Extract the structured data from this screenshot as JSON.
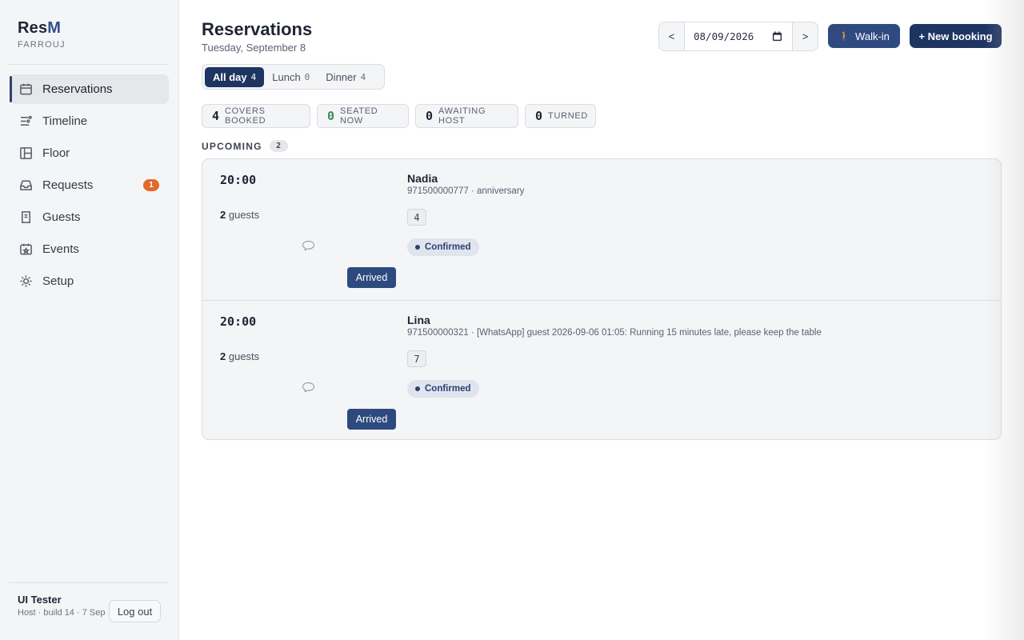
{
  "brand": {
    "name_prefix": "Res",
    "name_suffix": "M",
    "subtitle": "FARROUJ"
  },
  "nav": {
    "items": [
      {
        "label": "Reservations",
        "icon": "calendar-icon",
        "active": true
      },
      {
        "label": "Timeline",
        "icon": "timeline-icon"
      },
      {
        "label": "Floor",
        "icon": "floor-plan-icon"
      },
      {
        "label": "Requests",
        "icon": "inbox-icon",
        "badge": "1"
      },
      {
        "label": "Guests",
        "icon": "guests-book-icon"
      },
      {
        "label": "Events",
        "icon": "event-calendar-icon"
      },
      {
        "label": "Setup",
        "icon": "gear-icon"
      }
    ]
  },
  "user": {
    "name": "UI Tester",
    "role": "Host · build 14 · 7 Sep",
    "logout_label": "Log out"
  },
  "header": {
    "title": "Reservations",
    "date_label": "Tuesday, September 8",
    "prev_label": "<",
    "next_label": ">",
    "date_value": "08/09/2026",
    "walkin_label": "Walk-in",
    "new_booking_label": "+ New booking"
  },
  "segments": [
    {
      "label": "All day",
      "count": "4",
      "active": true
    },
    {
      "label": "Lunch",
      "count": "0"
    },
    {
      "label": "Dinner",
      "count": "4"
    }
  ],
  "stats": [
    {
      "value": "4",
      "label": "COVERS BOOKED"
    },
    {
      "value": "0",
      "label": "SEATED NOW"
    },
    {
      "value": "0",
      "label": "AWAITING HOST"
    },
    {
      "value": "0",
      "label": "TURNED"
    }
  ],
  "upcoming": {
    "label": "UPCOMING",
    "count": "2"
  },
  "reservations": [
    {
      "time": "20:00",
      "guests_num": "2",
      "guests_word": "guests",
      "name": "Nadia",
      "meta": "971500000777 · anniversary",
      "table": "4",
      "status": "Confirmed",
      "action": "Arrived"
    },
    {
      "time": "20:00",
      "guests_num": "2",
      "guests_word": "guests",
      "name": "Lina",
      "meta": "971500000321 · [WhatsApp] guest 2026-09-06 01:05: Running 15 minutes late, please keep the table",
      "table": "7",
      "status": "Confirmed",
      "action": "Arrived"
    }
  ],
  "colors": {
    "primary": "#1e3461",
    "accent_orange": "#e26a2c",
    "seated_green": "#3b8a5a"
  }
}
